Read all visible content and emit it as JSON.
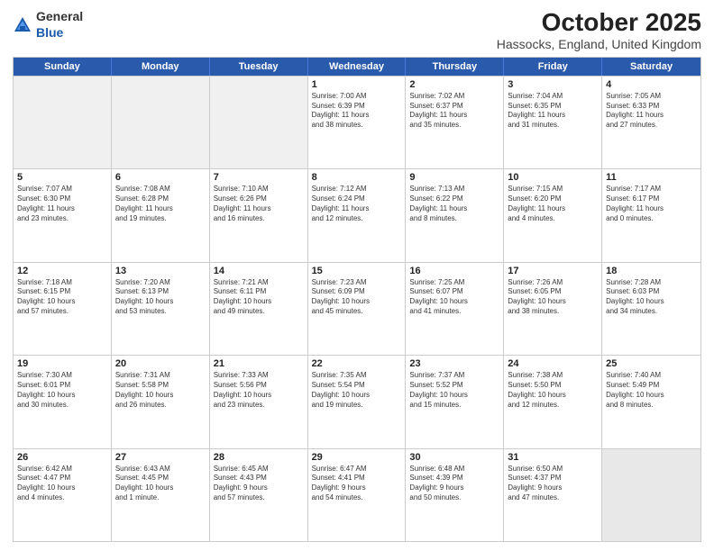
{
  "header": {
    "logo_general": "General",
    "logo_blue": "Blue",
    "title": "October 2025",
    "subtitle": "Hassocks, England, United Kingdom"
  },
  "days_of_week": [
    "Sunday",
    "Monday",
    "Tuesday",
    "Wednesday",
    "Thursday",
    "Friday",
    "Saturday"
  ],
  "weeks": [
    [
      {
        "day": "",
        "empty": true
      },
      {
        "day": "",
        "empty": true
      },
      {
        "day": "",
        "empty": true
      },
      {
        "day": "1",
        "lines": [
          "Sunrise: 7:00 AM",
          "Sunset: 6:39 PM",
          "Daylight: 11 hours",
          "and 38 minutes."
        ]
      },
      {
        "day": "2",
        "lines": [
          "Sunrise: 7:02 AM",
          "Sunset: 6:37 PM",
          "Daylight: 11 hours",
          "and 35 minutes."
        ]
      },
      {
        "day": "3",
        "lines": [
          "Sunrise: 7:04 AM",
          "Sunset: 6:35 PM",
          "Daylight: 11 hours",
          "and 31 minutes."
        ]
      },
      {
        "day": "4",
        "lines": [
          "Sunrise: 7:05 AM",
          "Sunset: 6:33 PM",
          "Daylight: 11 hours",
          "and 27 minutes."
        ]
      }
    ],
    [
      {
        "day": "5",
        "lines": [
          "Sunrise: 7:07 AM",
          "Sunset: 6:30 PM",
          "Daylight: 11 hours",
          "and 23 minutes."
        ]
      },
      {
        "day": "6",
        "lines": [
          "Sunrise: 7:08 AM",
          "Sunset: 6:28 PM",
          "Daylight: 11 hours",
          "and 19 minutes."
        ]
      },
      {
        "day": "7",
        "lines": [
          "Sunrise: 7:10 AM",
          "Sunset: 6:26 PM",
          "Daylight: 11 hours",
          "and 16 minutes."
        ]
      },
      {
        "day": "8",
        "lines": [
          "Sunrise: 7:12 AM",
          "Sunset: 6:24 PM",
          "Daylight: 11 hours",
          "and 12 minutes."
        ]
      },
      {
        "day": "9",
        "lines": [
          "Sunrise: 7:13 AM",
          "Sunset: 6:22 PM",
          "Daylight: 11 hours",
          "and 8 minutes."
        ]
      },
      {
        "day": "10",
        "lines": [
          "Sunrise: 7:15 AM",
          "Sunset: 6:20 PM",
          "Daylight: 11 hours",
          "and 4 minutes."
        ]
      },
      {
        "day": "11",
        "lines": [
          "Sunrise: 7:17 AM",
          "Sunset: 6:17 PM",
          "Daylight: 11 hours",
          "and 0 minutes."
        ]
      }
    ],
    [
      {
        "day": "12",
        "lines": [
          "Sunrise: 7:18 AM",
          "Sunset: 6:15 PM",
          "Daylight: 10 hours",
          "and 57 minutes."
        ]
      },
      {
        "day": "13",
        "lines": [
          "Sunrise: 7:20 AM",
          "Sunset: 6:13 PM",
          "Daylight: 10 hours",
          "and 53 minutes."
        ]
      },
      {
        "day": "14",
        "lines": [
          "Sunrise: 7:21 AM",
          "Sunset: 6:11 PM",
          "Daylight: 10 hours",
          "and 49 minutes."
        ]
      },
      {
        "day": "15",
        "lines": [
          "Sunrise: 7:23 AM",
          "Sunset: 6:09 PM",
          "Daylight: 10 hours",
          "and 45 minutes."
        ]
      },
      {
        "day": "16",
        "lines": [
          "Sunrise: 7:25 AM",
          "Sunset: 6:07 PM",
          "Daylight: 10 hours",
          "and 41 minutes."
        ]
      },
      {
        "day": "17",
        "lines": [
          "Sunrise: 7:26 AM",
          "Sunset: 6:05 PM",
          "Daylight: 10 hours",
          "and 38 minutes."
        ]
      },
      {
        "day": "18",
        "lines": [
          "Sunrise: 7:28 AM",
          "Sunset: 6:03 PM",
          "Daylight: 10 hours",
          "and 34 minutes."
        ]
      }
    ],
    [
      {
        "day": "19",
        "lines": [
          "Sunrise: 7:30 AM",
          "Sunset: 6:01 PM",
          "Daylight: 10 hours",
          "and 30 minutes."
        ]
      },
      {
        "day": "20",
        "lines": [
          "Sunrise: 7:31 AM",
          "Sunset: 5:58 PM",
          "Daylight: 10 hours",
          "and 26 minutes."
        ]
      },
      {
        "day": "21",
        "lines": [
          "Sunrise: 7:33 AM",
          "Sunset: 5:56 PM",
          "Daylight: 10 hours",
          "and 23 minutes."
        ]
      },
      {
        "day": "22",
        "lines": [
          "Sunrise: 7:35 AM",
          "Sunset: 5:54 PM",
          "Daylight: 10 hours",
          "and 19 minutes."
        ]
      },
      {
        "day": "23",
        "lines": [
          "Sunrise: 7:37 AM",
          "Sunset: 5:52 PM",
          "Daylight: 10 hours",
          "and 15 minutes."
        ]
      },
      {
        "day": "24",
        "lines": [
          "Sunrise: 7:38 AM",
          "Sunset: 5:50 PM",
          "Daylight: 10 hours",
          "and 12 minutes."
        ]
      },
      {
        "day": "25",
        "lines": [
          "Sunrise: 7:40 AM",
          "Sunset: 5:49 PM",
          "Daylight: 10 hours",
          "and 8 minutes."
        ]
      }
    ],
    [
      {
        "day": "26",
        "lines": [
          "Sunrise: 6:42 AM",
          "Sunset: 4:47 PM",
          "Daylight: 10 hours",
          "and 4 minutes."
        ]
      },
      {
        "day": "27",
        "lines": [
          "Sunrise: 6:43 AM",
          "Sunset: 4:45 PM",
          "Daylight: 10 hours",
          "and 1 minute."
        ]
      },
      {
        "day": "28",
        "lines": [
          "Sunrise: 6:45 AM",
          "Sunset: 4:43 PM",
          "Daylight: 9 hours",
          "and 57 minutes."
        ]
      },
      {
        "day": "29",
        "lines": [
          "Sunrise: 6:47 AM",
          "Sunset: 4:41 PM",
          "Daylight: 9 hours",
          "and 54 minutes."
        ]
      },
      {
        "day": "30",
        "lines": [
          "Sunrise: 6:48 AM",
          "Sunset: 4:39 PM",
          "Daylight: 9 hours",
          "and 50 minutes."
        ]
      },
      {
        "day": "31",
        "lines": [
          "Sunrise: 6:50 AM",
          "Sunset: 4:37 PM",
          "Daylight: 9 hours",
          "and 47 minutes."
        ]
      },
      {
        "day": "",
        "empty": true,
        "shade": true
      }
    ]
  ]
}
